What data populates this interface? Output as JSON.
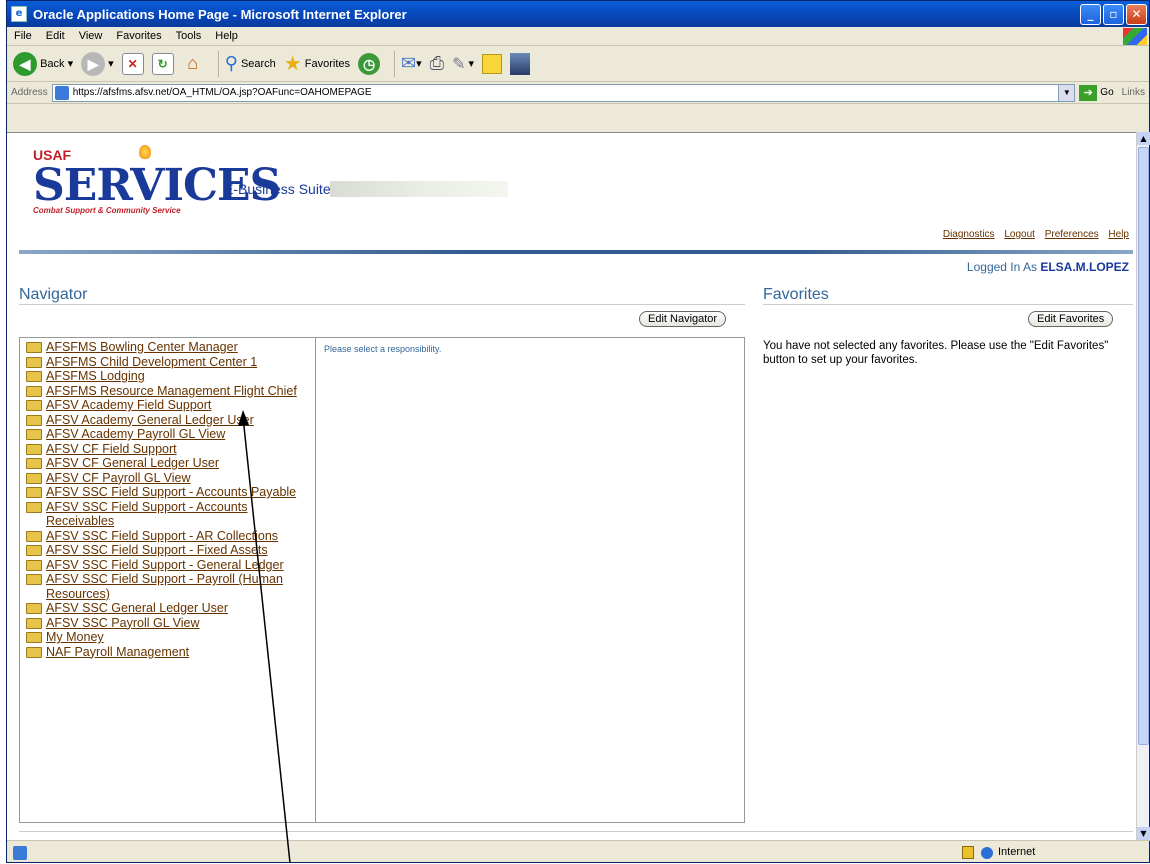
{
  "window": {
    "title": "Oracle Applications Home Page - Microsoft Internet Explorer"
  },
  "menu": [
    "File",
    "Edit",
    "View",
    "Favorites",
    "Tools",
    "Help"
  ],
  "toolbar": {
    "back": "Back",
    "search": "Search",
    "favorites": "Favorites"
  },
  "address": {
    "label": "Address",
    "url": "https://afsfms.afsv.net/OA_HTML/OA.jsp?OAFunc=OAHOMEPAGE",
    "go": "Go",
    "links": "Links"
  },
  "header": {
    "logo_top": "USAF",
    "logo_main": "SERVICES",
    "logo_sub": "Combat Support & Community Service",
    "suite": "E-Business Suite",
    "global_links": [
      "Diagnostics",
      "Logout",
      "Preferences",
      "Help"
    ],
    "logged_in_label": "Logged In As",
    "user": "ELSA.M.LOPEZ"
  },
  "navigator": {
    "title": "Navigator",
    "edit_button": "Edit Navigator",
    "message": "Please select a responsibility.",
    "items": [
      "AFSFMS Bowling Center Manager",
      "AFSFMS Child Development Center 1",
      "AFSFMS Lodging",
      "AFSFMS Resource Management Flight Chief",
      "AFSV Academy Field Support",
      "AFSV Academy General Ledger User",
      "AFSV Academy Payroll GL View",
      "AFSV CF Field Support",
      "AFSV CF General Ledger User",
      "AFSV CF Payroll GL View",
      "AFSV SSC Field Support - Accounts Payable",
      "AFSV SSC Field Support - Accounts Receivables",
      "AFSV SSC Field Support - AR Collections",
      "AFSV SSC Field Support - Fixed Assets",
      "AFSV SSC Field Support - General Ledger",
      "AFSV SSC Field Support - Payroll (Human Resources)",
      "AFSV SSC General Ledger User",
      "AFSV SSC Payroll GL View",
      "My Money",
      "NAF Payroll Management"
    ]
  },
  "favorites": {
    "title": "Favorites",
    "edit_button": "Edit Favorites",
    "message": "You have not selected any favorites. Please use the \"Edit Favorites\" button to set up your favorites."
  },
  "status": {
    "zone": "Internet"
  }
}
